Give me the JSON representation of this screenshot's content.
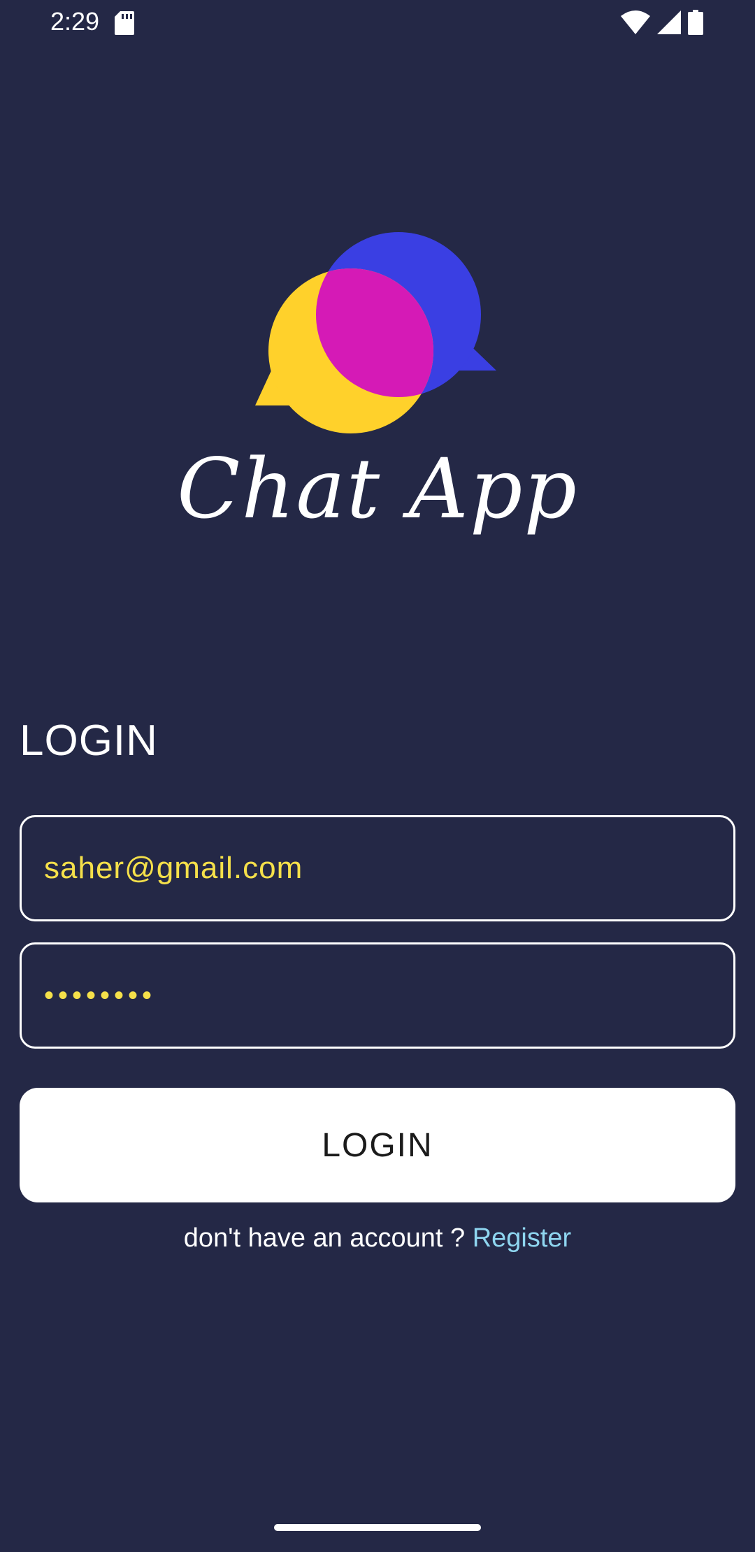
{
  "status_bar": {
    "time": "2:29",
    "icons": [
      "sd-card-icon",
      "wifi-icon",
      "signal-icon",
      "battery-icon"
    ]
  },
  "logo": {
    "app_name": "Chat App",
    "colors": {
      "yellow": "#FFD12B",
      "blue": "#3A3FE3",
      "magenta": "#D51AB6"
    }
  },
  "login": {
    "heading": "LOGIN",
    "email_value": "saher@gmail.com",
    "password_value": "••••••••",
    "button_label": "LOGIN",
    "register_prompt": "don't have an account ? ",
    "register_link": "Register"
  },
  "colors": {
    "background": "#242846",
    "field_text": "#F5E04A",
    "link": "#8FD6F0",
    "button_bg": "#FFFFFF"
  }
}
